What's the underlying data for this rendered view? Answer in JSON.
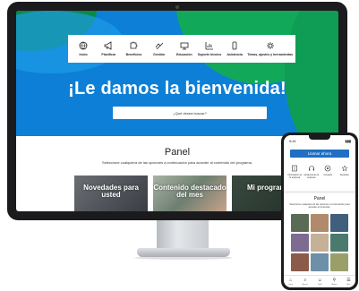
{
  "desktop": {
    "nav": [
      {
        "label": "Inicio",
        "icon": "globe-icon"
      },
      {
        "label": "Planificar",
        "icon": "megaphone-icon"
      },
      {
        "label": "Beneficios",
        "icon": "puzzle-icon"
      },
      {
        "label": "Gestión",
        "icon": "hands-icon"
      },
      {
        "label": "Educación",
        "icon": "monitor-icon"
      },
      {
        "label": "Soporte técnico",
        "icon": "chart-icon"
      },
      {
        "label": "Asistencia",
        "icon": "phone-icon"
      },
      {
        "label": "Temas, ajustes y herramientas",
        "icon": "gear-icon"
      }
    ],
    "welcome_title": "¡Le damos la bienvenida!",
    "search_placeholder": "¿Qué desea buscar?",
    "panel_title": "Panel",
    "panel_description": "Seleccione cualquiera de las opciones a continuación para acceder al contenido del programa.",
    "cards": [
      {
        "label": "Novedades para usted"
      },
      {
        "label": "Contenido destacado del mes"
      },
      {
        "label": "Mi programa"
      }
    ]
  },
  "phone": {
    "time": "9:41",
    "call_button": "Llamar ahora",
    "icons": [
      {
        "label": "Información de la empresa",
        "icon": "building-icon"
      },
      {
        "label": "Asistencia de la empresa",
        "icon": "headset-icon"
      },
      {
        "label": "Contacto",
        "icon": "chat-icon"
      },
      {
        "label": "Favoritos",
        "icon": "star-icon"
      }
    ],
    "panel_title": "Panel",
    "panel_description": "Seleccione cualquiera de las opciones a continuación para acceder al contenido.",
    "tabs": [
      {
        "glyph": "⌂",
        "label": "Inicio"
      },
      {
        "glyph": "⌕",
        "label": "Buscar"
      },
      {
        "glyph": "☺",
        "label": "Perfil"
      },
      {
        "glyph": "⚲",
        "label": "Avisos"
      },
      {
        "glyph": "☰",
        "label": "Más"
      }
    ],
    "tile_colors": [
      "#5a6b55",
      "#b08a6a",
      "#3f5f7c",
      "#7e6b91",
      "#c4b197",
      "#4a7a6e",
      "#8a5a4a",
      "#6e8fa8",
      "#9a9f6a"
    ]
  },
  "colors": {
    "hero_blue": "#0d7fd6",
    "hero_green": "#11a85a",
    "accent_button": "#1f6fc4"
  }
}
